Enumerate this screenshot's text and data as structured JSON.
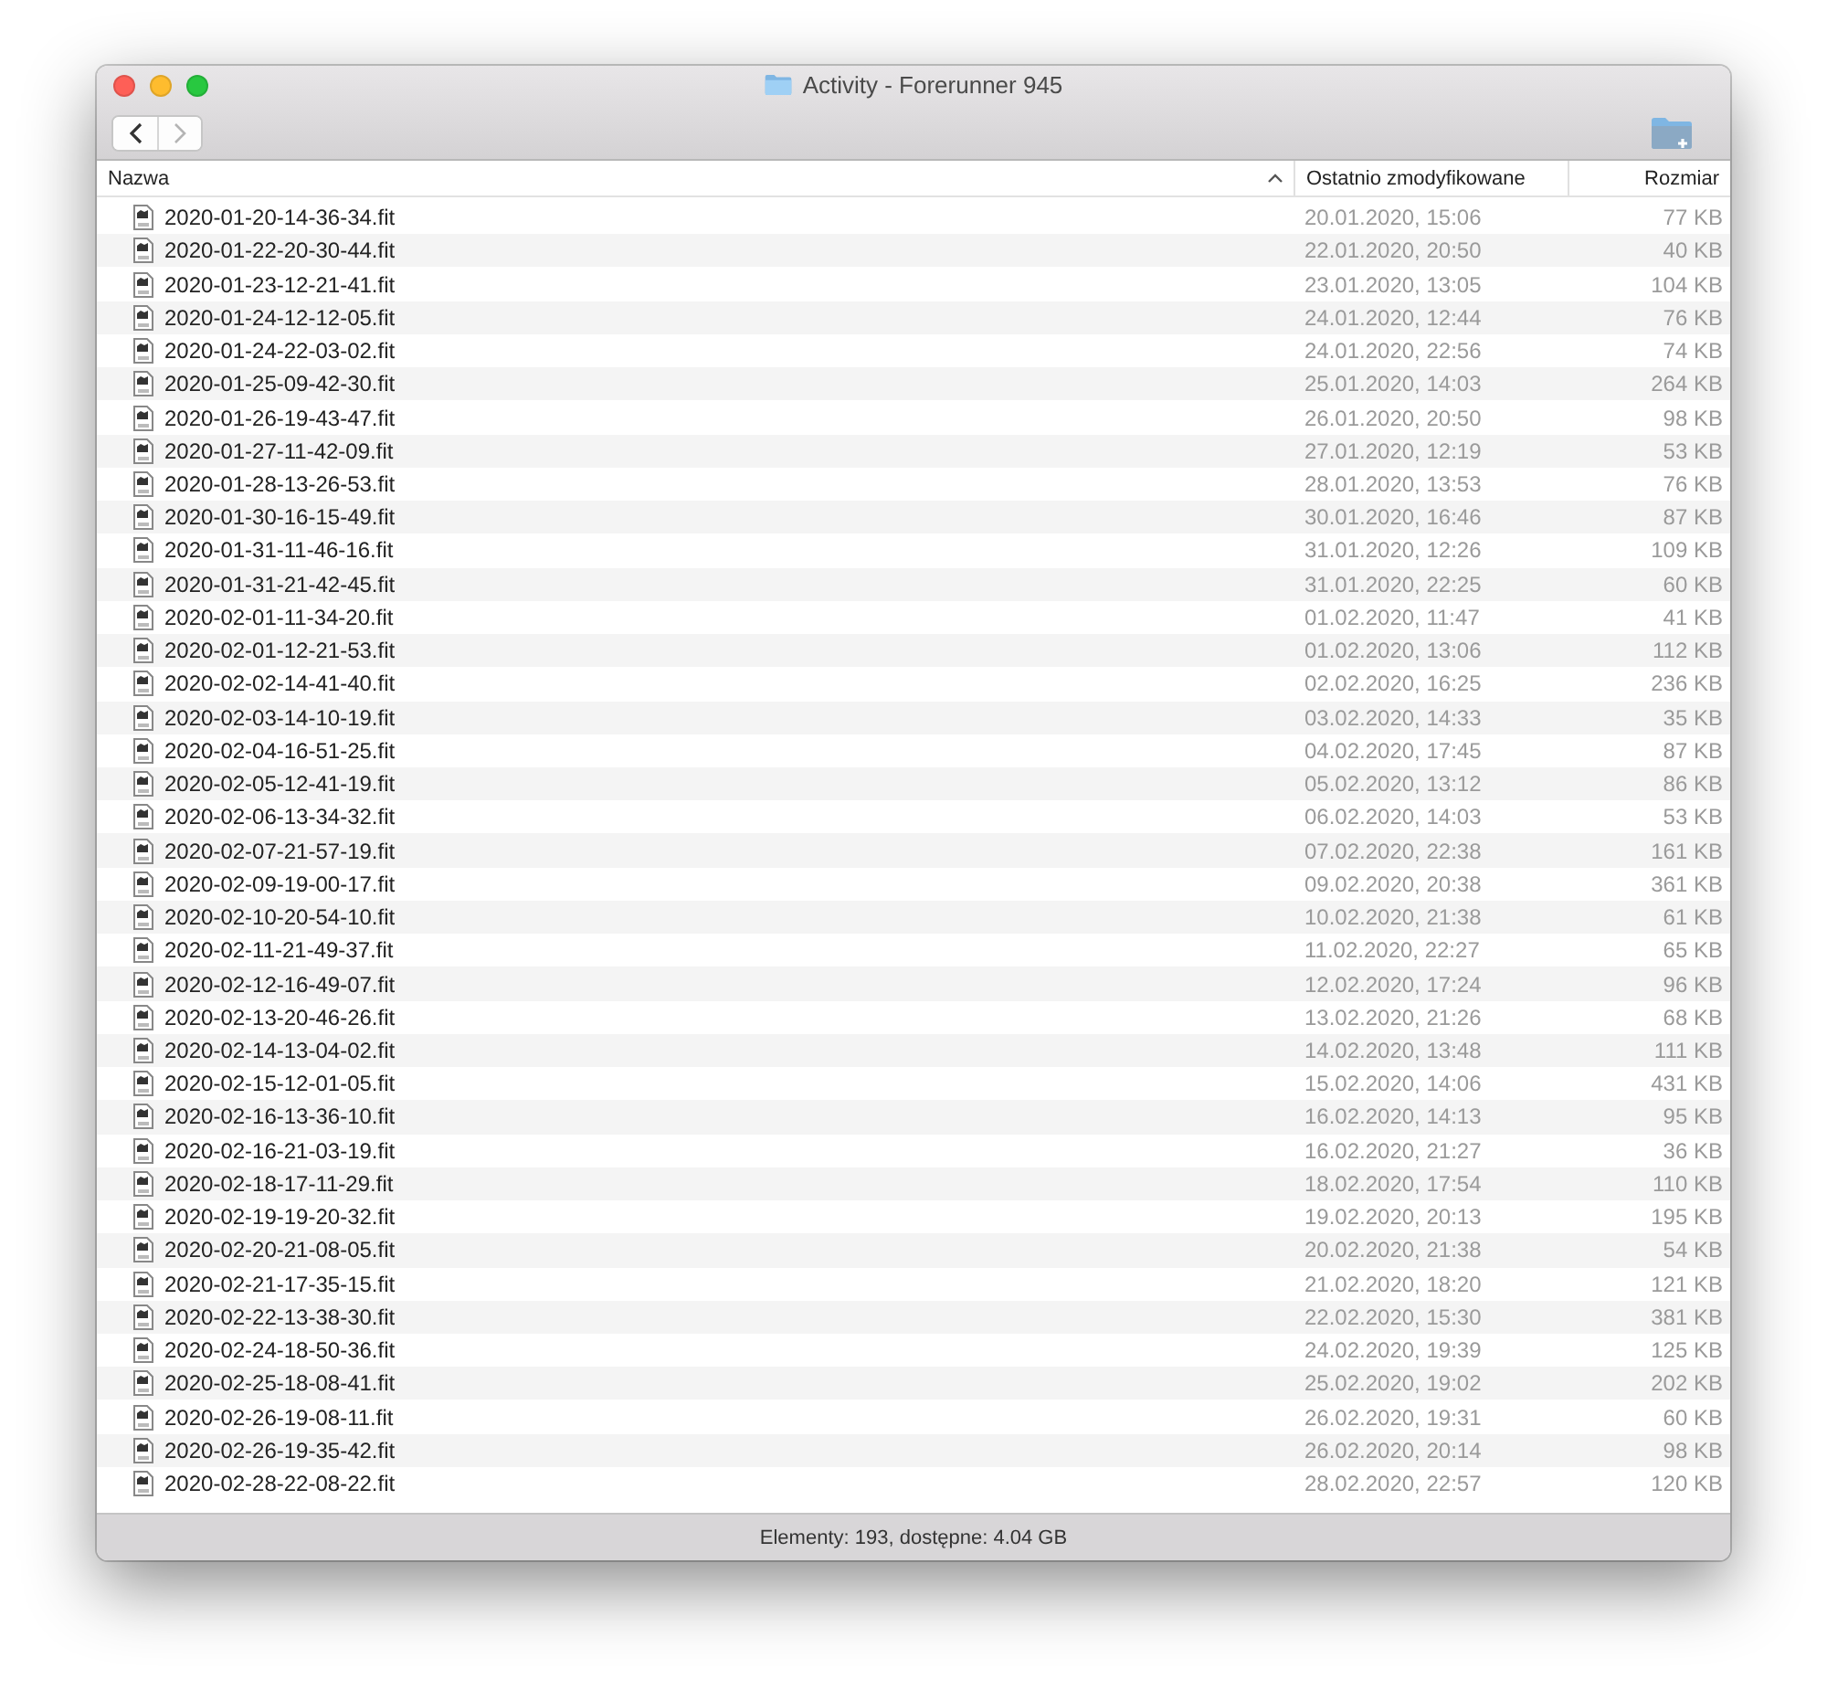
{
  "window": {
    "title": "Activity - Forerunner 945"
  },
  "toolbar": {
    "back": {
      "disabled": false
    },
    "forward": {
      "disabled": true
    }
  },
  "table": {
    "columns": [
      {
        "label": "Nazwa",
        "sorted": true
      },
      {
        "label": "Ostatnio zmodyfikowane",
        "sorted": false
      },
      {
        "label": "Rozmiar",
        "sorted": false
      }
    ],
    "rows": [
      {
        "name": "2020-01-20-14-36-34.fit",
        "modified": "20.01.2020, 15:06",
        "size": "77 KB"
      },
      {
        "name": "2020-01-22-20-30-44.fit",
        "modified": "22.01.2020, 20:50",
        "size": "40 KB"
      },
      {
        "name": "2020-01-23-12-21-41.fit",
        "modified": "23.01.2020, 13:05",
        "size": "104 KB"
      },
      {
        "name": "2020-01-24-12-12-05.fit",
        "modified": "24.01.2020, 12:44",
        "size": "76 KB"
      },
      {
        "name": "2020-01-24-22-03-02.fit",
        "modified": "24.01.2020, 22:56",
        "size": "74 KB"
      },
      {
        "name": "2020-01-25-09-42-30.fit",
        "modified": "25.01.2020, 14:03",
        "size": "264 KB"
      },
      {
        "name": "2020-01-26-19-43-47.fit",
        "modified": "26.01.2020, 20:50",
        "size": "98 KB"
      },
      {
        "name": "2020-01-27-11-42-09.fit",
        "modified": "27.01.2020, 12:19",
        "size": "53 KB"
      },
      {
        "name": "2020-01-28-13-26-53.fit",
        "modified": "28.01.2020, 13:53",
        "size": "76 KB"
      },
      {
        "name": "2020-01-30-16-15-49.fit",
        "modified": "30.01.2020, 16:46",
        "size": "87 KB"
      },
      {
        "name": "2020-01-31-11-46-16.fit",
        "modified": "31.01.2020, 12:26",
        "size": "109 KB"
      },
      {
        "name": "2020-01-31-21-42-45.fit",
        "modified": "31.01.2020, 22:25",
        "size": "60 KB"
      },
      {
        "name": "2020-02-01-11-34-20.fit",
        "modified": "01.02.2020, 11:47",
        "size": "41 KB"
      },
      {
        "name": "2020-02-01-12-21-53.fit",
        "modified": "01.02.2020, 13:06",
        "size": "112 KB"
      },
      {
        "name": "2020-02-02-14-41-40.fit",
        "modified": "02.02.2020, 16:25",
        "size": "236 KB"
      },
      {
        "name": "2020-02-03-14-10-19.fit",
        "modified": "03.02.2020, 14:33",
        "size": "35 KB"
      },
      {
        "name": "2020-02-04-16-51-25.fit",
        "modified": "04.02.2020, 17:45",
        "size": "87 KB"
      },
      {
        "name": "2020-02-05-12-41-19.fit",
        "modified": "05.02.2020, 13:12",
        "size": "86 KB"
      },
      {
        "name": "2020-02-06-13-34-32.fit",
        "modified": "06.02.2020, 14:03",
        "size": "53 KB"
      },
      {
        "name": "2020-02-07-21-57-19.fit",
        "modified": "07.02.2020, 22:38",
        "size": "161 KB"
      },
      {
        "name": "2020-02-09-19-00-17.fit",
        "modified": "09.02.2020, 20:38",
        "size": "361 KB"
      },
      {
        "name": "2020-02-10-20-54-10.fit",
        "modified": "10.02.2020, 21:38",
        "size": "61 KB"
      },
      {
        "name": "2020-02-11-21-49-37.fit",
        "modified": "11.02.2020, 22:27",
        "size": "65 KB"
      },
      {
        "name": "2020-02-12-16-49-07.fit",
        "modified": "12.02.2020, 17:24",
        "size": "96 KB"
      },
      {
        "name": "2020-02-13-20-46-26.fit",
        "modified": "13.02.2020, 21:26",
        "size": "68 KB"
      },
      {
        "name": "2020-02-14-13-04-02.fit",
        "modified": "14.02.2020, 13:48",
        "size": "111 KB"
      },
      {
        "name": "2020-02-15-12-01-05.fit",
        "modified": "15.02.2020, 14:06",
        "size": "431 KB"
      },
      {
        "name": "2020-02-16-13-36-10.fit",
        "modified": "16.02.2020, 14:13",
        "size": "95 KB"
      },
      {
        "name": "2020-02-16-21-03-19.fit",
        "modified": "16.02.2020, 21:27",
        "size": "36 KB"
      },
      {
        "name": "2020-02-18-17-11-29.fit",
        "modified": "18.02.2020, 17:54",
        "size": "110 KB"
      },
      {
        "name": "2020-02-19-19-20-32.fit",
        "modified": "19.02.2020, 20:13",
        "size": "195 KB"
      },
      {
        "name": "2020-02-20-21-08-05.fit",
        "modified": "20.02.2020, 21:38",
        "size": "54 KB"
      },
      {
        "name": "2020-02-21-17-35-15.fit",
        "modified": "21.02.2020, 18:20",
        "size": "121 KB"
      },
      {
        "name": "2020-02-22-13-38-30.fit",
        "modified": "22.02.2020, 15:30",
        "size": "381 KB"
      },
      {
        "name": "2020-02-24-18-50-36.fit",
        "modified": "24.02.2020, 19:39",
        "size": "125 KB"
      },
      {
        "name": "2020-02-25-18-08-41.fit",
        "modified": "25.02.2020, 19:02",
        "size": "202 KB"
      },
      {
        "name": "2020-02-26-19-08-11.fit",
        "modified": "26.02.2020, 19:31",
        "size": "60 KB"
      },
      {
        "name": "2020-02-26-19-35-42.fit",
        "modified": "26.02.2020, 20:14",
        "size": "98 KB"
      },
      {
        "name": "2020-02-28-22-08-22.fit",
        "modified": "28.02.2020, 22:57",
        "size": "120 KB"
      }
    ]
  },
  "status_bar": {
    "text": "Elementy: 193, dostępne: 4.04 GB"
  }
}
